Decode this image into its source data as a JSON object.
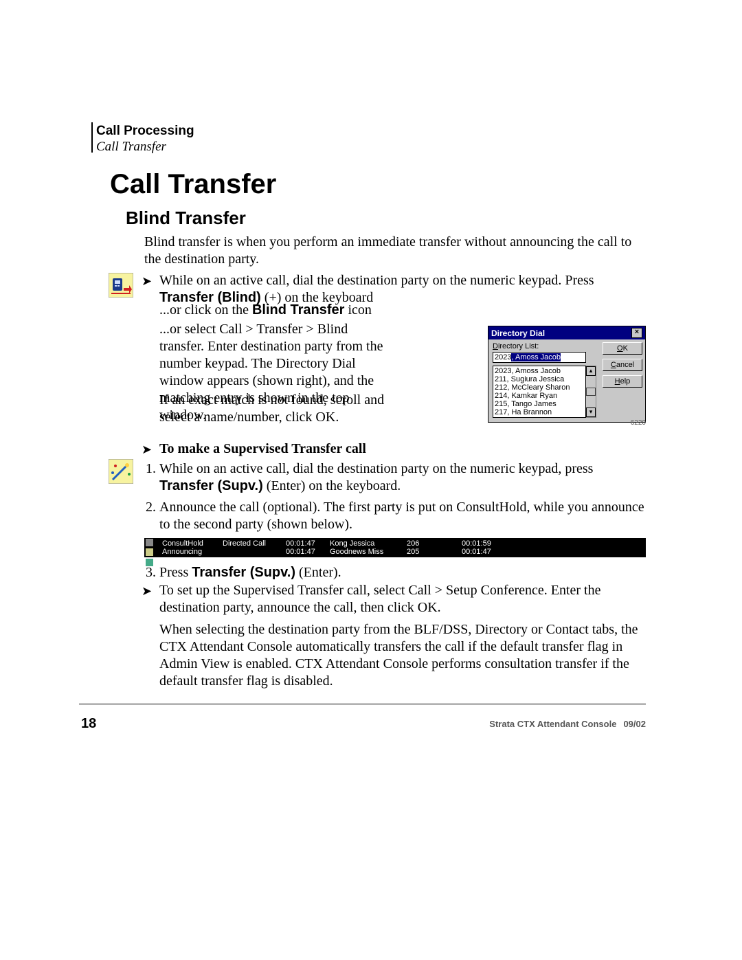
{
  "header": {
    "section": "Call Processing",
    "subsection": "Call Transfer"
  },
  "title": "Call Transfer",
  "subtitle": "Blind Transfer",
  "intro": "Blind transfer is when you perform an immediate transfer without announcing the call to the destination party.",
  "bullet1_pre": "While on an active call, dial the destination party on the numeric keypad. Press ",
  "bullet1_bold": "Transfer (Blind)",
  "bullet1_post": " (+) on the keyboard",
  "or1_pre": "...or click on the ",
  "or1_bold": "Blind Transfer",
  "or1_post": " icon",
  "or2": "...or select Call > Transfer > Blind transfer. Enter destination party from the number keypad. The Directory Dial window appears (shown right), and the matching entry is shown in the top window.",
  "if1": "If an exact match is not found, scroll and select a name/number, click OK.",
  "dirdial": {
    "title": "Directory Dial",
    "label": "Directory List:",
    "input_prefix": "2023",
    "input_sel": ", Amoss Jacob",
    "items": [
      "2023, Amoss Jacob",
      "211, Sugiura Jessica",
      "212, McCleary Sharon",
      "214, Kamkar Ryan",
      "215, Tango James",
      "217, Ha Brannon"
    ],
    "ok": "OK",
    "cancel": "Cancel",
    "help": "Help"
  },
  "fig_num": "6220",
  "sup_header": "To make a Supervised Transfer call",
  "step1_pre": "While on an active call, dial the destination party on the numeric keypad, press ",
  "step1_bold": "Transfer (Supv.)",
  "step1_post": " (Enter) on the keyboard.",
  "step2": "Announce the call (optional). The first party is put on ConsultHold, while you announce to the second party (shown below).",
  "callstrip": {
    "rows": [
      {
        "state": "ConsultHold",
        "dir": "Directed Call",
        "t1": "00:01:47",
        "name": "Kong Jessica",
        "ext": "206",
        "t2": "00:01:59"
      },
      {
        "state": "Announcing",
        "dir": "",
        "t1": "00:01:47",
        "name": "Goodnews Miss",
        "ext": "205",
        "t2": "00:01:47"
      }
    ]
  },
  "step3_pre": "Press ",
  "step3_bold": "Transfer (Supv.)",
  "step3_post": " (Enter).",
  "setup": "To set up the Supervised Transfer call, select Call > Setup Conference. Enter the destination party, announce the call, then click OK.",
  "last": "When selecting the destination party from the BLF/DSS, Directory or Contact tabs, the CTX Attendant Console automatically transfers the call if the default transfer flag in Admin View is enabled. CTX Attendant Console performs consultation transfer if the default transfer flag is disabled.",
  "footer": {
    "page": "18",
    "doc": "Strata CTX Attendant Console",
    "date": "09/02"
  },
  "icons": {
    "blind": "blind-transfer-icon",
    "wand": "supervised-transfer-icon"
  }
}
